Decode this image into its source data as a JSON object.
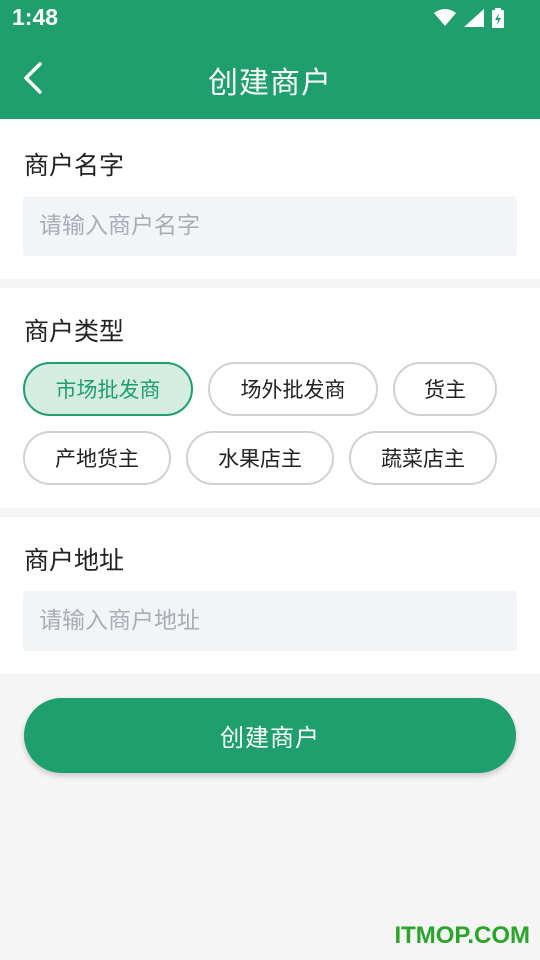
{
  "status_bar": {
    "time": "1:48",
    "icons": [
      "wifi-icon",
      "signal-icon",
      "battery-charging-icon"
    ]
  },
  "app_bar": {
    "title": "创建商户",
    "back_icon": "back-arrow-icon"
  },
  "form": {
    "name_section": {
      "label": "商户名字",
      "placeholder": "请输入商户名字",
      "value": ""
    },
    "type_section": {
      "label": "商户类型",
      "options": [
        {
          "label": "市场批发商",
          "selected": true
        },
        {
          "label": "场外批发商",
          "selected": false
        },
        {
          "label": "货主",
          "selected": false
        },
        {
          "label": "产地货主",
          "selected": false
        },
        {
          "label": "水果店主",
          "selected": false
        },
        {
          "label": "蔬菜店主",
          "selected": false
        }
      ]
    },
    "address_section": {
      "label": "商户地址",
      "placeholder": "请输入商户地址",
      "value": ""
    }
  },
  "submit_label": "创建商户",
  "watermark": "ITMOP.COM",
  "colors": {
    "primary": "#1f9e6e",
    "chip_selected_bg": "#d4ece2",
    "input_bg": "#f2f4f8",
    "page_bg": "#f4f5f4"
  }
}
